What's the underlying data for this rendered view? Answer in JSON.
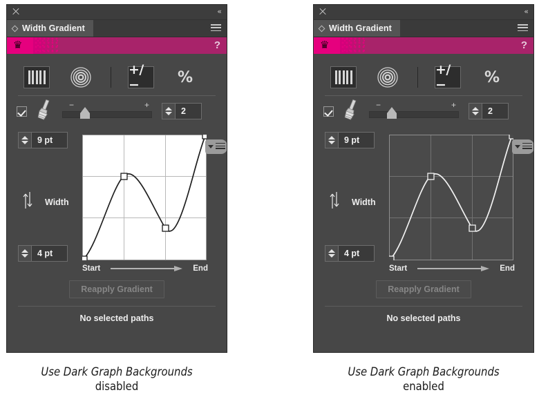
{
  "panels": [
    {
      "id": "light",
      "titlebar": {
        "close_icon": "close-icon",
        "collapse_icon": "collapse-double-chevron-icon"
      },
      "tab": {
        "label": "Width Gradient",
        "diamond_icon": "diamond-icon",
        "menu_icon": "hamburger-menu-icon"
      },
      "promo": {
        "crown_icon": "crown-icon",
        "help_label": "?"
      },
      "toolbar": {
        "stripes_icon": "width-stripes-icon",
        "rings_icon": "concentric-rings-icon",
        "plusminus_label": "+/−",
        "percent_label": "%"
      },
      "brushrow": {
        "checkbox_checked": true,
        "brush_icon": "paintbrush-icon",
        "slider_minus": "−",
        "slider_plus": "+",
        "slider_value_pct": 20,
        "count_value": "2"
      },
      "graph": {
        "max_value": "9 pt",
        "min_value": "4 pt",
        "axis_label": "Width",
        "axis_icon": "up-down-arrows-icon",
        "flyout_icon": "graph-flyout-menu-icon",
        "start_label": "Start",
        "end_label": "End",
        "dark_background": false
      },
      "reapply_label": "Reapply Gradient",
      "status_label": "No selected paths",
      "caption_line1": "Use Dark Graph Backgrounds",
      "caption_line2": "disabled"
    },
    {
      "id": "dark",
      "titlebar": {
        "close_icon": "close-icon",
        "collapse_icon": "collapse-double-chevron-icon"
      },
      "tab": {
        "label": "Width Gradient",
        "diamond_icon": "diamond-icon",
        "menu_icon": "hamburger-menu-icon"
      },
      "promo": {
        "crown_icon": "crown-icon",
        "help_label": "?"
      },
      "toolbar": {
        "stripes_icon": "width-stripes-icon",
        "rings_icon": "concentric-rings-icon",
        "plusminus_label": "+/−",
        "percent_label": "%"
      },
      "brushrow": {
        "checkbox_checked": true,
        "brush_icon": "paintbrush-icon",
        "slider_minus": "−",
        "slider_plus": "+",
        "slider_value_pct": 20,
        "count_value": "2"
      },
      "graph": {
        "max_value": "9 pt",
        "min_value": "4 pt",
        "axis_label": "Width",
        "axis_icon": "up-down-arrows-icon",
        "flyout_icon": "graph-flyout-menu-icon",
        "start_label": "Start",
        "end_label": "End",
        "dark_background": true
      },
      "reapply_label": "Reapply Gradient",
      "status_label": "No selected paths",
      "caption_line1": "Use Dark Graph Backgrounds",
      "caption_line2": "enabled"
    }
  ],
  "colors": {
    "panel_background": "#474747",
    "tab_active": "#545454",
    "promo_pink": "#e6007e",
    "promo_magenta": "#a8236a",
    "graph_light_background": "#ffffff",
    "graph_dark_background": "#4a4a4a",
    "graph_curve_light": "#1a1a1a",
    "graph_curve_dark": "#f0f0f0",
    "grid_light": "#b3b3b3",
    "grid_dark": "#6e6e6e"
  },
  "chart_data": {
    "type": "line",
    "title": "Width Gradient profile",
    "xlabel": "Start → End",
    "ylabel": "Width",
    "ylim": [
      4,
      9
    ],
    "y_tick_labels": [
      "4 pt",
      "9 pt"
    ],
    "grid": true,
    "grid_divisions_x": 3,
    "grid_divisions_y": 3,
    "control_points": [
      {
        "x": 0.0,
        "y": 0.0,
        "handle": "square"
      },
      {
        "x": 0.3333,
        "y": 0.6667,
        "handle": "square"
      },
      {
        "x": 0.6667,
        "y": 0.2222,
        "handle": "square"
      },
      {
        "x": 1.0,
        "y": 1.0,
        "handle": "square"
      }
    ],
    "note": "x normalized 0=Start 1=End; y normalized 0=4 pt, 1=9 pt"
  }
}
